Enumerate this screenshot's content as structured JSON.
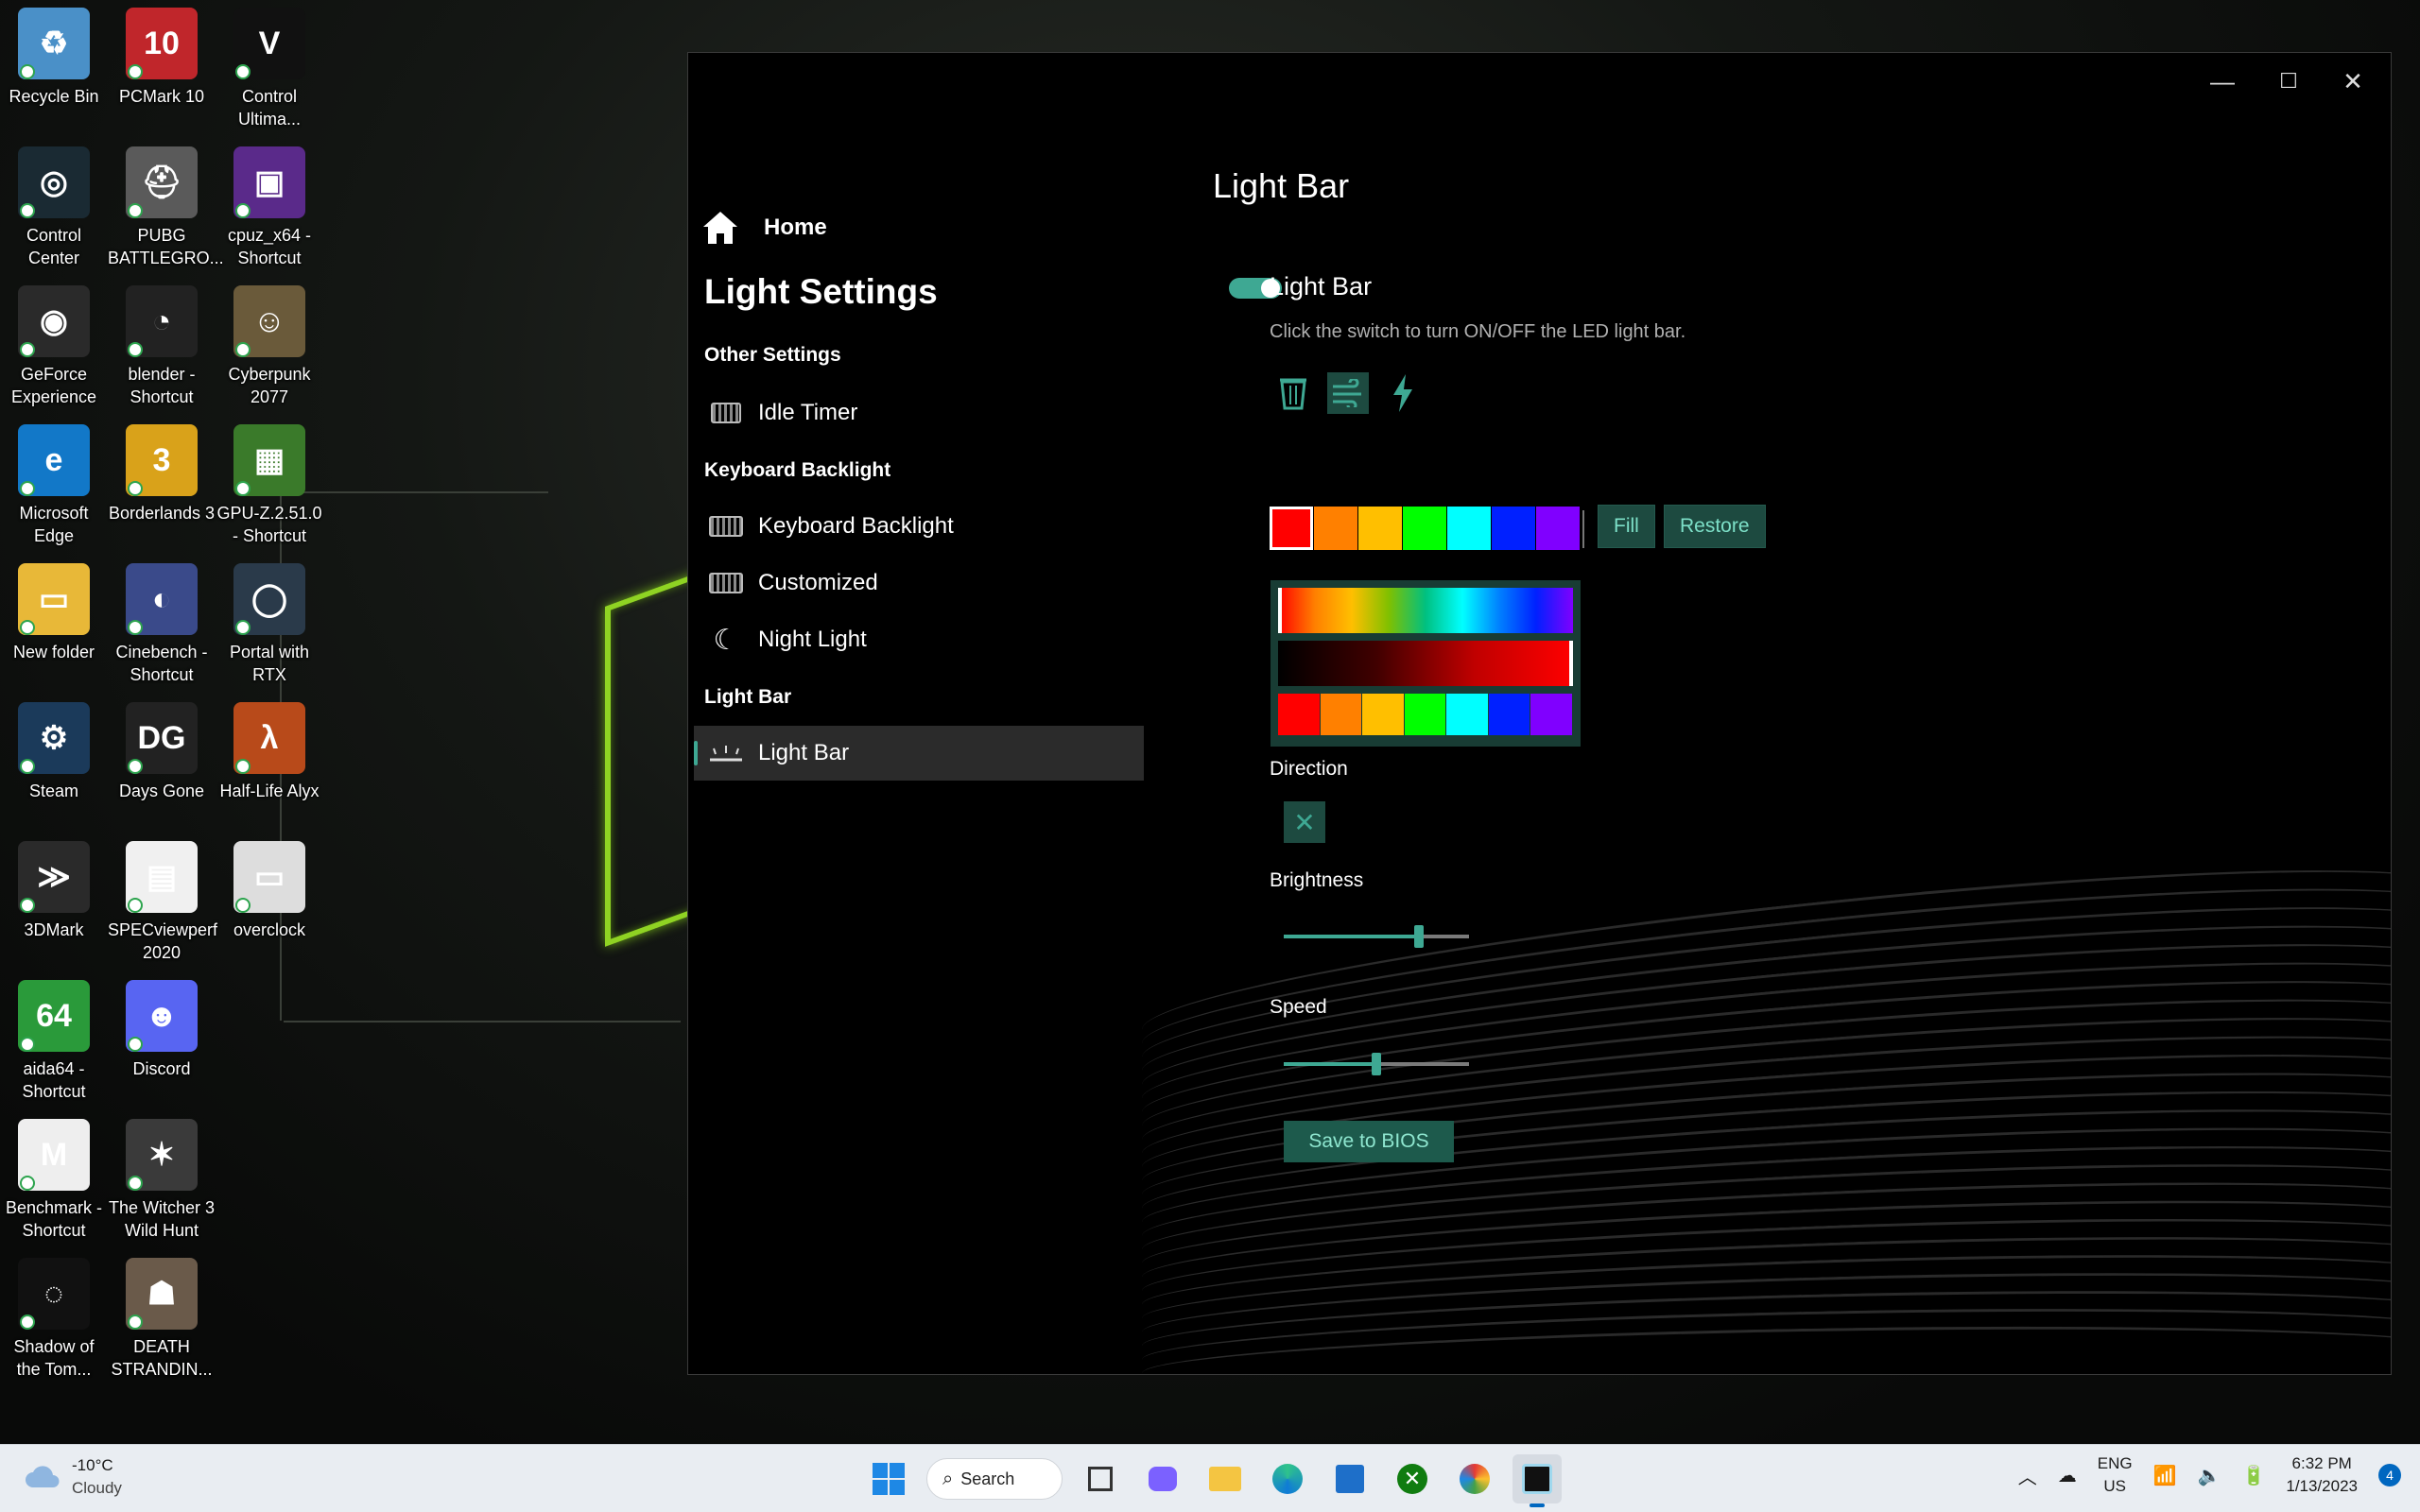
{
  "desktop": {
    "icons": [
      {
        "label": "Recycle Bin",
        "bg": "#4a90c8",
        "glyph": "♻"
      },
      {
        "label": "PCMark 10",
        "bg": "#c0262b",
        "glyph": "10"
      },
      {
        "label": "Control\nUltima...",
        "bg": "#111111",
        "glyph": "V"
      },
      {
        "label": "Control\nCenter",
        "bg": "#1a2a33",
        "glyph": "◎"
      },
      {
        "label": "PUBG\nBATTLEGRO...",
        "bg": "#5a5a5a",
        "glyph": "⛑"
      },
      {
        "label": "cpuz_x64 -\nShortcut",
        "bg": "#5a2a8a",
        "glyph": "▣"
      },
      {
        "label": "GeForce\nExperience",
        "bg": "#2a2a2a",
        "glyph": "◉"
      },
      {
        "label": "blender -\nShortcut",
        "bg": "#222222",
        "glyph": "◔"
      },
      {
        "label": "Cyberpunk\n2077",
        "bg": "#6a5a3a",
        "glyph": "☺"
      },
      {
        "label": "Microsoft\nEdge",
        "bg": "#1278c8",
        "glyph": "e"
      },
      {
        "label": "Borderlands 3",
        "bg": "#d9a21a",
        "glyph": "3"
      },
      {
        "label": "GPU-Z.2.51.0\n- Shortcut",
        "bg": "#3a7a2a",
        "glyph": "▦"
      },
      {
        "label": "New folder",
        "bg": "#e8b838",
        "glyph": "▭"
      },
      {
        "label": "Cinebench -\nShortcut",
        "bg": "#3a4a8a",
        "glyph": "◐"
      },
      {
        "label": "Portal with\nRTX",
        "bg": "#2a3a4a",
        "glyph": "◯"
      },
      {
        "label": "Steam",
        "bg": "#1b3a5a",
        "glyph": "⚙"
      },
      {
        "label": "Days Gone",
        "bg": "#222222",
        "glyph": "DG"
      },
      {
        "label": "Half-Life Alyx",
        "bg": "#b84a1a",
        "glyph": "λ"
      },
      {
        "label": "3DMark",
        "bg": "#2a2a2a",
        "glyph": "≫"
      },
      {
        "label": "SPECviewperf\n2020",
        "bg": "#f0f0f0",
        "glyph": "▤"
      },
      {
        "label": "overclock",
        "bg": "#dddddd",
        "glyph": "▭"
      },
      {
        "label": "aida64 -\nShortcut",
        "bg": "#2a9a3a",
        "glyph": "64"
      },
      {
        "label": "Discord",
        "bg": "#5865f2",
        "glyph": "☻"
      },
      {
        "label": "",
        "bg": "transparent",
        "glyph": ""
      },
      {
        "label": "Benchmark -\nShortcut",
        "bg": "#eeeeee",
        "glyph": "M"
      },
      {
        "label": "The Witcher 3\nWild Hunt",
        "bg": "#3a3a3a",
        "glyph": "✶"
      },
      {
        "label": "",
        "bg": "transparent",
        "glyph": ""
      },
      {
        "label": "Shadow of\nthe Tom...",
        "bg": "#111111",
        "glyph": "◌"
      },
      {
        "label": "DEATH\nSTRANDIN...",
        "bg": "#6a5a4a",
        "glyph": "☗"
      }
    ]
  },
  "window": {
    "controls": {
      "minimize": "—",
      "maximize": "☐",
      "close": "✕"
    }
  },
  "sidebar": {
    "home": "Home",
    "title": "Light Settings",
    "headers": {
      "other": "Other Settings",
      "keyboard": "Keyboard Backlight",
      "lightbar": "Light Bar"
    },
    "items": {
      "idle_timer": "Idle Timer",
      "keyboard_backlight": "Keyboard Backlight",
      "customized": "Customized",
      "night_light": "Night Light",
      "light_bar": "Light Bar"
    }
  },
  "content": {
    "title": "Light Bar",
    "toggle": {
      "label": "Light Bar",
      "on": true,
      "description": "Click the switch to turn ON/OFF the LED light bar."
    },
    "mode_icons": [
      "trash-bin-icon",
      "wind-fan-icon",
      "lightning-icon"
    ],
    "swatches": [
      "#ff0000",
      "#ff8000",
      "#ffbf00",
      "#00ff00",
      "#00ffff",
      "#0020ff",
      "#8000ff"
    ],
    "fill_label": "Fill",
    "restore_label": "Restore",
    "direction_label": "Direction",
    "brightness_label": "Brightness",
    "speed_label": "Speed",
    "brightness_value": 0.73,
    "speed_value": 0.5,
    "save_label": "Save to BIOS",
    "accent": "#3ea893"
  },
  "taskbar": {
    "weather_temp": "-10°C",
    "weather_cond": "Cloudy",
    "search_label": "Search",
    "lang_1": "ENG",
    "lang_2": "US",
    "time": "6:32 PM",
    "date": "1/13/2023",
    "notifications": "4"
  }
}
